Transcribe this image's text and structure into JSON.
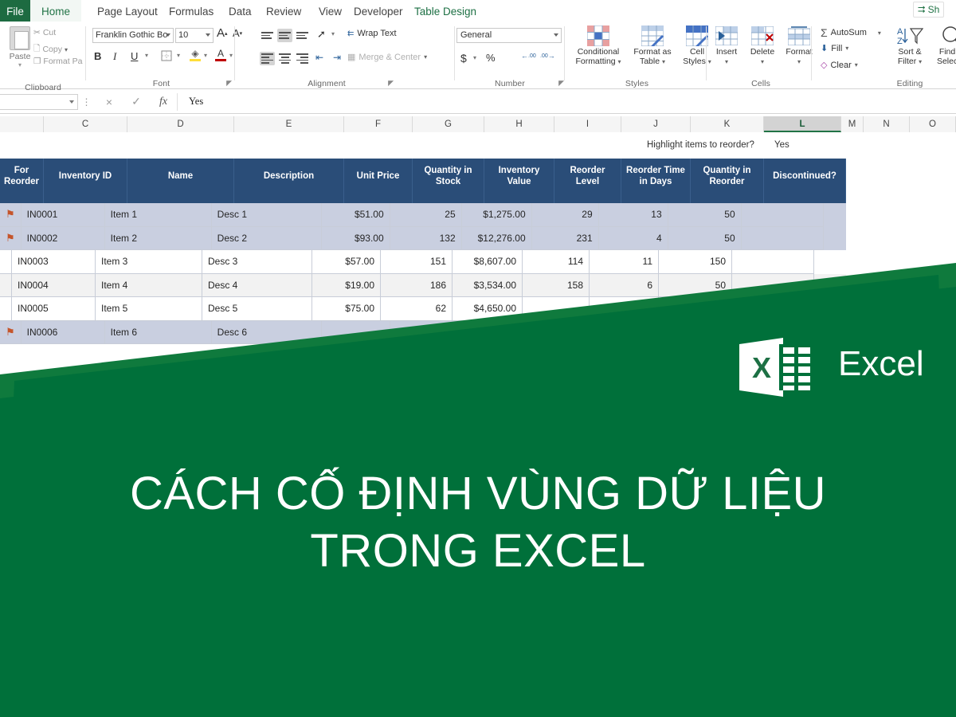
{
  "window": {
    "share_label": "Sh",
    "share_icon": "share-icon"
  },
  "ribbon": {
    "tabs": [
      {
        "label": "File",
        "state": "file"
      },
      {
        "label": "Home",
        "state": "active"
      },
      {
        "label": "Page Layout",
        "state": "normal"
      },
      {
        "label": "Formulas",
        "state": "normal"
      },
      {
        "label": "Data",
        "state": "normal"
      },
      {
        "label": "Review",
        "state": "normal"
      },
      {
        "label": "View",
        "state": "normal"
      },
      {
        "label": "Developer",
        "state": "normal"
      },
      {
        "label": "Table Design",
        "state": "contextual"
      }
    ],
    "groups": {
      "clipboard": {
        "label": "Clipboard",
        "paste": "Paste",
        "cut": "Cut",
        "copy": "Copy",
        "format_painter": "Format Pa"
      },
      "font": {
        "label": "Font",
        "font_name": "Franklin Gothic Bo",
        "font_size": "10",
        "grow_font": "A",
        "shrink_font": "A",
        "bold": "B",
        "italic": "I",
        "underline": "U",
        "borders": "borders-icon",
        "fill_color": "fill-color-icon",
        "font_color": "A"
      },
      "alignment": {
        "label": "Alignment",
        "wrap_text": "Wrap Text",
        "merge_center": "Merge & Center"
      },
      "number": {
        "label": "Number",
        "format": "General",
        "currency": "$",
        "percent": "%",
        "comma": "",
        "increase_decimal": ".00",
        "decrease_decimal": ".00"
      },
      "styles": {
        "label": "Styles",
        "conditional_formatting": "Conditional\nFormatting",
        "conditional_formatting_l1": "Conditional",
        "conditional_formatting_l2": "Formatting",
        "format_as_table_l1": "Format as",
        "format_as_table_l2": "Table",
        "cell_styles_l1": "Cell",
        "cell_styles_l2": "Styles"
      },
      "cells": {
        "label": "Cells",
        "insert": "Insert",
        "delete": "Delete",
        "format": "Format"
      },
      "editing": {
        "label": "Editing",
        "autosum": "AutoSum",
        "fill": "Fill",
        "clear": "Clear",
        "sort_filter_l1": "Sort &",
        "sort_filter_l2": "Filter",
        "find_select_l1": "Find &",
        "find_select_l2": "Select"
      }
    }
  },
  "formula_bar": {
    "name_box": "",
    "cancel": "×",
    "enter": "✓",
    "insert_function": "fx",
    "value": "Yes"
  },
  "grid": {
    "columns": [
      "C",
      "D",
      "E",
      "F",
      "G",
      "H",
      "I",
      "J",
      "K",
      "L",
      "M",
      "N",
      "O"
    ],
    "selected_column": "L",
    "note_label": "Highlight items to reorder?",
    "note_value": "Yes"
  },
  "table": {
    "headers": [
      "For Reorder",
      "Inventory ID",
      "Name",
      "Description",
      "Unit Price",
      "Quantity in Stock",
      "Inventory Value",
      "Reorder Level",
      "Reorder Time in Days",
      "Quantity in Reorder",
      "Discontinued?"
    ],
    "rows": [
      {
        "flag": "⚑",
        "id": "IN0001",
        "name": "Item 1",
        "desc": "Desc 1",
        "price": "$51.00",
        "qty": "25",
        "value": "$1,275.00",
        "level": "29",
        "days": "13",
        "reorder": "50",
        "disc": "",
        "style": "hl"
      },
      {
        "flag": "⚑",
        "id": "IN0002",
        "name": "Item 2",
        "desc": "Desc 2",
        "price": "$93.00",
        "qty": "132",
        "value": "$12,276.00",
        "level": "231",
        "days": "4",
        "reorder": "50",
        "disc": "",
        "style": "hl"
      },
      {
        "flag": "",
        "id": "IN0003",
        "name": "Item 3",
        "desc": "Desc 3",
        "price": "$57.00",
        "qty": "151",
        "value": "$8,607.00",
        "level": "114",
        "days": "11",
        "reorder": "150",
        "disc": "",
        "style": "plain"
      },
      {
        "flag": "",
        "id": "IN0004",
        "name": "Item 4",
        "desc": "Desc 4",
        "price": "$19.00",
        "qty": "186",
        "value": "$3,534.00",
        "level": "158",
        "days": "6",
        "reorder": "50",
        "disc": "",
        "style": "alt"
      },
      {
        "flag": "",
        "id": "IN0005",
        "name": "Item 5",
        "desc": "Desc 5",
        "price": "$75.00",
        "qty": "62",
        "value": "$4,650.00",
        "level": "",
        "days": "",
        "reorder": "",
        "disc": "",
        "style": "plain"
      },
      {
        "flag": "⚑",
        "id": "IN0006",
        "name": "Item 6",
        "desc": "Desc 6",
        "price": "",
        "qty": "",
        "value": "",
        "level": "",
        "days": "",
        "reorder": "",
        "disc": "",
        "style": "hl"
      }
    ]
  },
  "banner": {
    "title_line1": "CÁCH CỐ ĐỊNH VÙNG DỮ LIỆU",
    "title_line2": "TRONG EXCEL",
    "logo_word": "Excel",
    "logo_letter": "X",
    "green": "#00703a",
    "green_light": "#0f7a3d"
  }
}
